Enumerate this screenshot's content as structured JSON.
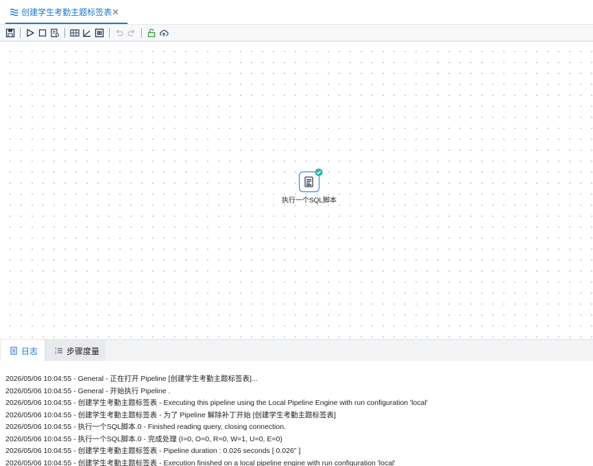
{
  "tab": {
    "title": "创建学生考勤主题标签表",
    "close": "✕",
    "icon": "pipeline-icon"
  },
  "toolbar": {
    "buttons": [
      "save-icon",
      "run-icon",
      "stop-icon",
      "preview-icon",
      "grid-icon",
      "align-icon",
      "datagrid-icon",
      "undo-icon",
      "redo-icon",
      "unlock-icon",
      "upload-cloud-icon"
    ]
  },
  "canvas": {
    "node": {
      "label": "执行一个SQL脚本",
      "icon": "sql-script-icon",
      "status": "success-check-icon"
    }
  },
  "bottom": {
    "tabs": [
      {
        "label": "日志",
        "icon": "log-icon",
        "active": true
      },
      {
        "label": "步骤度量",
        "icon": "metrics-list-icon",
        "active": false
      }
    ],
    "log_lines": [
      "2026/05/06 10:04:55 - General - 正在打开 Pipeline [创建学生考勤主题标签表]...",
      "2026/05/06 10:04:55 - General - 开始执行 Pipeline .",
      "2026/05/06 10:04:55 - 创建学生考勤主题标签表 - Executing this pipeline using the Local Pipeline Engine with run configuration 'local'",
      "2026/05/06 10:04:55 - 创建学生考勤主题标签表 - 为了 Pipeline 解除补丁开始 [创建学生考勤主题标签表]",
      "2026/05/06 10:04:55 - 执行一个SQL脚本.0 - Finished reading query, closing connection.",
      "2026/05/06 10:04:55 - 执行一个SQL脚本.0 - 完成处理 (I=0, O=0, R=0, W=1, U=0, E=0)",
      "2026/05/06 10:04:55 - 创建学生考勤主题标签表 - Pipeline duration : 0.026 seconds [  0.026\" ]",
      "2026/05/06 10:04:55 - 创建学生考勤主题标签表 - Execution finished on a local pipeline engine with run configuration 'local'"
    ]
  },
  "colors": {
    "accent": "#1976d2",
    "success": "#2bb5a8",
    "unlock": "#3aa14a"
  }
}
